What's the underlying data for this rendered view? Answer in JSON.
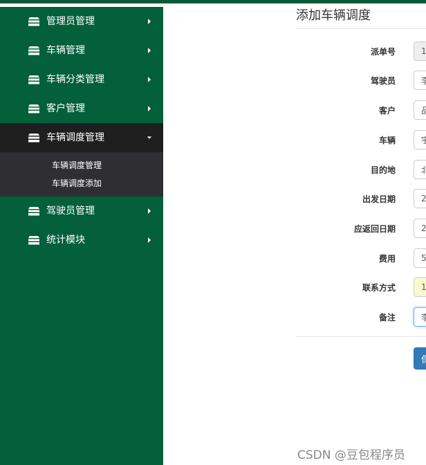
{
  "sidebar": {
    "items": [
      {
        "label": "管理员管理",
        "icon": "stack-icon",
        "caret": "right"
      },
      {
        "label": "车辆管理",
        "icon": "stack-icon",
        "caret": "right"
      },
      {
        "label": "车辆分类管理",
        "icon": "stack-icon",
        "caret": "right"
      },
      {
        "label": "客户管理",
        "icon": "stack-icon",
        "caret": "right"
      },
      {
        "label": "车辆调度管理",
        "icon": "stack-icon",
        "caret": "down",
        "expanded": true,
        "children": [
          {
            "label": "车辆调度管理"
          },
          {
            "label": "车辆调度添加"
          }
        ]
      },
      {
        "label": "驾驶员管理",
        "icon": "stack-icon",
        "caret": "right"
      },
      {
        "label": "统计模块",
        "icon": "stack-icon",
        "caret": "right"
      }
    ]
  },
  "page": {
    "title": "添加车辆调度"
  },
  "form": {
    "fields": [
      {
        "label": "派单号",
        "value": "1"
      },
      {
        "label": "驾驶员",
        "value": "李"
      },
      {
        "label": "客户",
        "value": "品"
      },
      {
        "label": "车辆",
        "value": "宇"
      },
      {
        "label": "目的地",
        "value": "北"
      },
      {
        "label": "出发日期",
        "value": "2"
      },
      {
        "label": "应返回日期",
        "value": "2"
      },
      {
        "label": "费用",
        "value": "5"
      },
      {
        "label": "联系方式",
        "value": "1"
      },
      {
        "label": "备注",
        "value": "李"
      }
    ],
    "save_label": "保"
  },
  "watermark": "CSDN @豆包程序员",
  "colors": {
    "sidebar_bg": "#045f3b",
    "active_item_bg": "#1f1f1f",
    "submenu_bg": "#2f2f33",
    "primary_button": "#337ab7"
  }
}
